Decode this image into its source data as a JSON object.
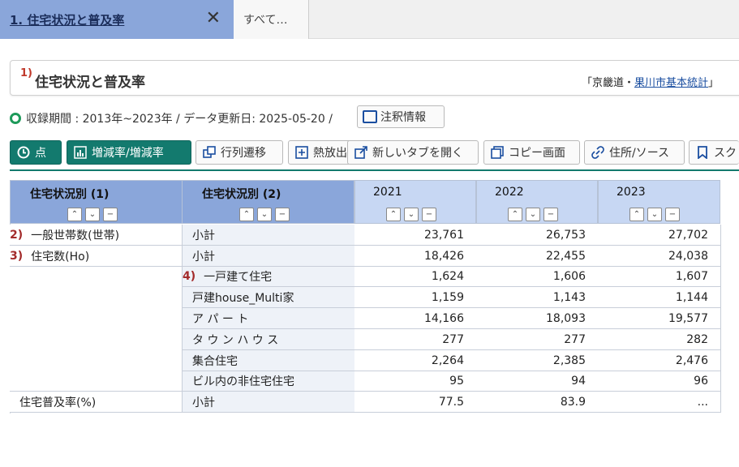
{
  "tabs": {
    "active_label": "1. 住宅状況と普及率",
    "close_glyph": "✕",
    "other_label": "すべて…"
  },
  "title_card": {
    "number": "1)",
    "title": "住宅状況と普及率",
    "source_prefix": "「京畿道・",
    "source_link": "果川市基本統計",
    "source_suffix": "」"
  },
  "meta": {
    "text": "収録期間 : 2013年~2023年 / データ更新日: 2025-05-20 /",
    "note_button": "注釈情報"
  },
  "toolbar": {
    "point": "点",
    "change_rate": "増減率/増減率",
    "row_col": "行列遷移",
    "pivot": "熱放出",
    "new_tab": "新しいタブを開く",
    "copy": "コピー画面",
    "address": "住所/ソース",
    "scroll": "スク"
  },
  "table": {
    "col_headers": [
      "住宅状況別 (1)",
      "住宅状況別 (2)",
      "2021",
      "2022",
      "2023"
    ],
    "sort_glyphs": [
      "⌃",
      "⌄",
      "−"
    ],
    "rows": [
      {
        "rn": "2)",
        "c1": "一般世帯数(世帯)",
        "c2": "小計",
        "rn2": "",
        "v": [
          "23,761",
          "26,753",
          "27,702"
        ]
      },
      {
        "rn": "3)",
        "c1": "住宅数(Ho)",
        "c2": "小計",
        "rn2": "",
        "v": [
          "18,426",
          "22,455",
          "24,038"
        ]
      },
      {
        "rn": "",
        "c1": "",
        "c2": "一戸建て住宅",
        "rn2": "4)",
        "v": [
          "1,624",
          "1,606",
          "1,607"
        ]
      },
      {
        "rn": "",
        "c1": "",
        "c2": "戸建house_Multi家",
        "rn2": "",
        "v": [
          "1,159",
          "1,143",
          "1,144"
        ]
      },
      {
        "rn": "",
        "c1": "",
        "c2": "ア パ ー ト",
        "rn2": "",
        "v": [
          "14,166",
          "18,093",
          "19,577"
        ]
      },
      {
        "rn": "",
        "c1": "",
        "c2": "タ ウ ン ハ ウ ス",
        "rn2": "",
        "v": [
          "277",
          "277",
          "282"
        ]
      },
      {
        "rn": "",
        "c1": "",
        "c2": "集合住宅",
        "rn2": "",
        "v": [
          "2,264",
          "2,385",
          "2,476"
        ]
      },
      {
        "rn": "",
        "c1": "",
        "c2": "ビル内の非住宅住宅",
        "rn2": "",
        "v": [
          "95",
          "94",
          "96"
        ]
      },
      {
        "rn": "",
        "c1": "住宅普及率(%)",
        "c2": "小計",
        "rn2": "",
        "v": [
          "77.5",
          "83.9",
          "..."
        ]
      }
    ]
  },
  "colors": {
    "accent_green": "#137a6e",
    "header_blue": "#8aa6da",
    "year_header": "#c7d7f3",
    "stub_bg": "#eef2f8",
    "note_red": "#a32b2b"
  }
}
